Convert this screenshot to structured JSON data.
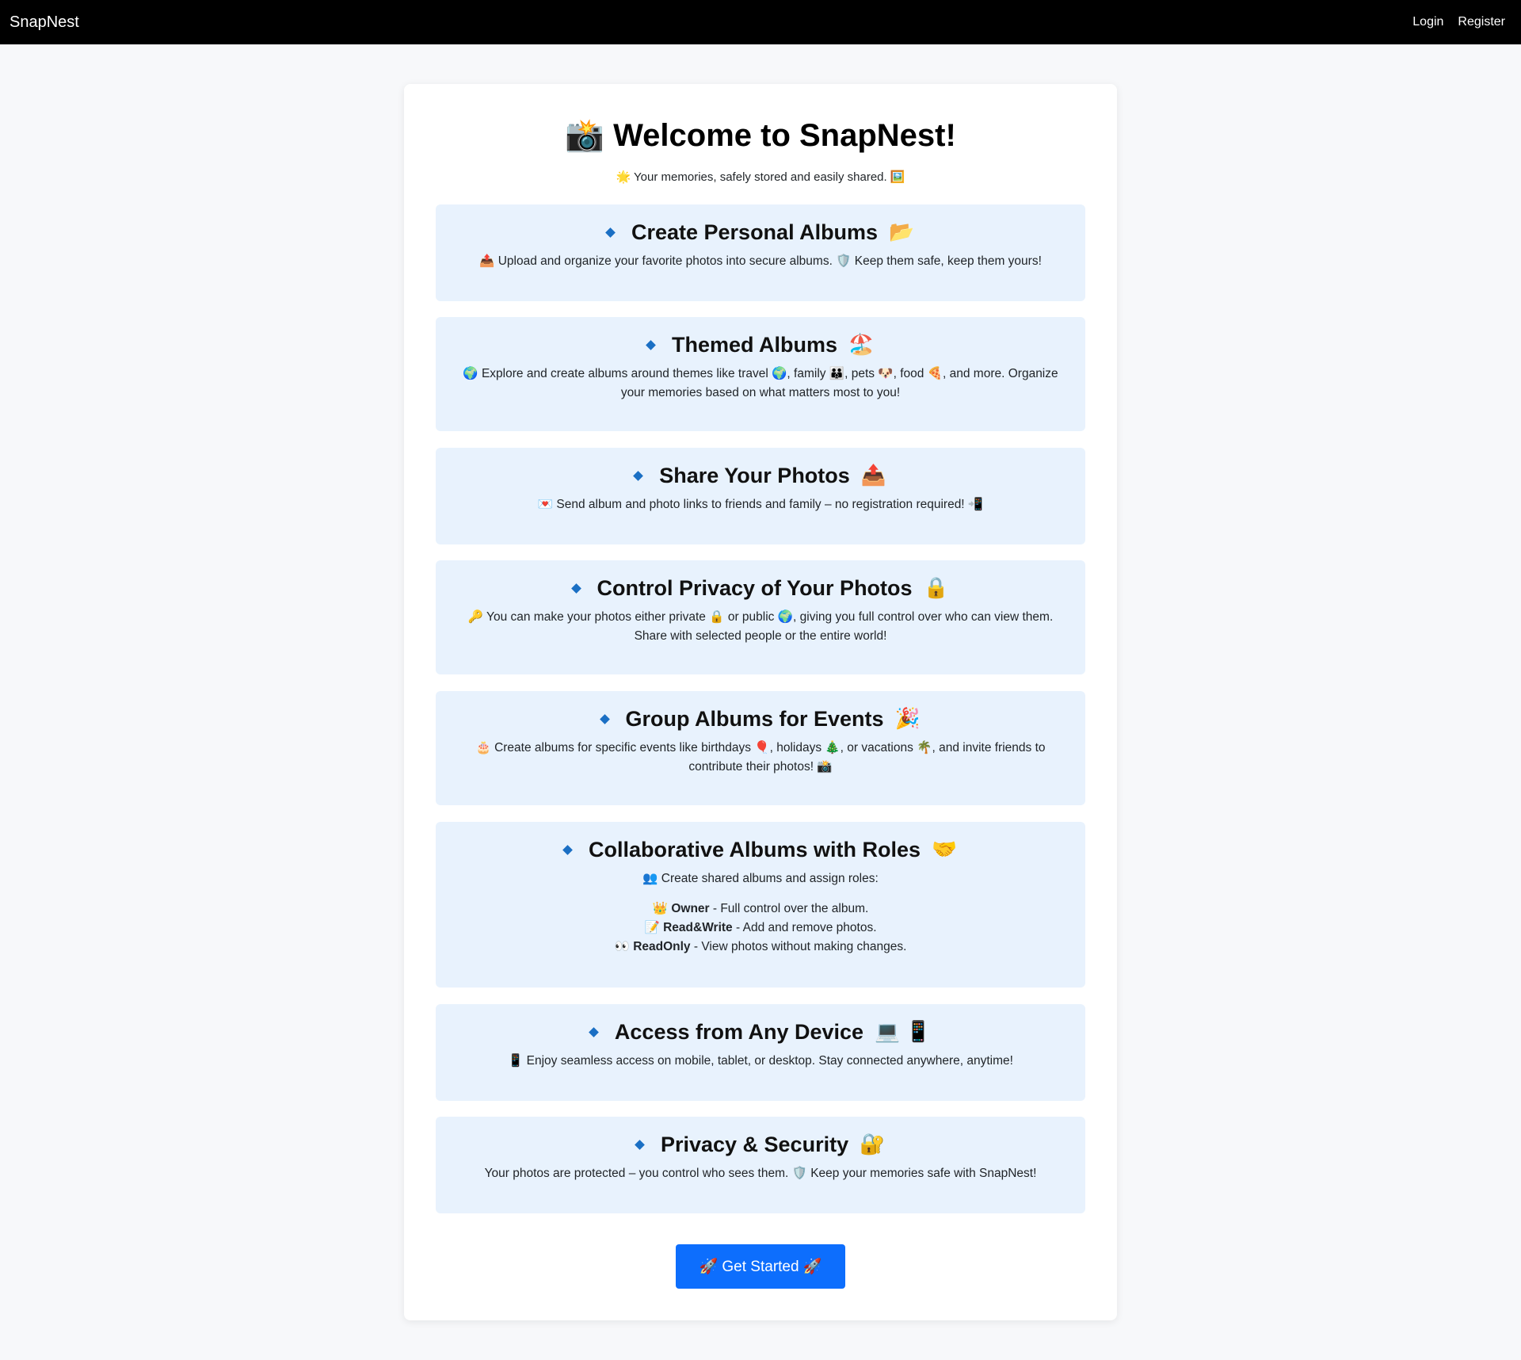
{
  "nav": {
    "brand": "SnapNest",
    "login": "Login",
    "register": "Register"
  },
  "hero": {
    "title": "📸 Welcome to SnapNest!",
    "subtitle": "🌟 Your memories, safely stored and easily shared. 🖼️"
  },
  "features": [
    {
      "title": "Create Personal Albums",
      "title_emoji": "📂",
      "desc": "📤 Upload and organize your favorite photos into secure albums. 🛡️ Keep them safe, keep them yours!"
    },
    {
      "title": "Themed Albums",
      "title_emoji": "🏖️",
      "desc": "🌍 Explore and create albums around themes like travel 🌍, family 👪, pets 🐶, food 🍕, and more. Organize your memories based on what matters most to you!"
    },
    {
      "title": "Share Your Photos",
      "title_emoji": "📤",
      "desc": "💌 Send album and photo links to friends and family – no registration required! 📲"
    },
    {
      "title": "Control Privacy of Your Photos",
      "title_emoji": "🔒",
      "desc": "🔑 You can make your photos either private 🔒 or public 🌍, giving you full control over who can view them. Share with selected people or the entire world!"
    },
    {
      "title": "Group Albums for Events",
      "title_emoji": "🎉",
      "desc": "🎂 Create albums for specific events like birthdays 🎈, holidays 🎄, or vacations 🌴, and invite friends to contribute their photos! 📸"
    },
    {
      "title": "Collaborative Albums with Roles",
      "title_emoji": "🤝",
      "desc": "👥 Create shared albums and assign roles:",
      "roles": [
        {
          "emoji": "👑",
          "name": "Owner",
          "text": " - Full control over the album."
        },
        {
          "emoji": "📝",
          "name": "Read&Write",
          "text": " - Add and remove photos."
        },
        {
          "emoji": "👀",
          "name": "ReadOnly",
          "text": " - View photos without making changes."
        }
      ]
    },
    {
      "title": "Access from Any Device",
      "title_emoji": "💻 📱",
      "desc": "📱 Enjoy seamless access on mobile, tablet, or desktop. Stay connected anywhere, anytime!"
    },
    {
      "title": "Privacy & Security",
      "title_emoji": "🔐",
      "desc": "Your photos are protected – you control who sees them. 🛡️ Keep your memories safe with SnapNest!"
    }
  ],
  "cta": {
    "label": "🚀 Get Started 🚀"
  },
  "colors": {
    "navbar": "#000000",
    "page_bg": "#f7f8fa",
    "feature_bg": "#e8f2fd",
    "diamond": "#1a6fc4",
    "button": "#0d6efd"
  },
  "icons": {
    "feature_bullet": "diamond-icon"
  }
}
